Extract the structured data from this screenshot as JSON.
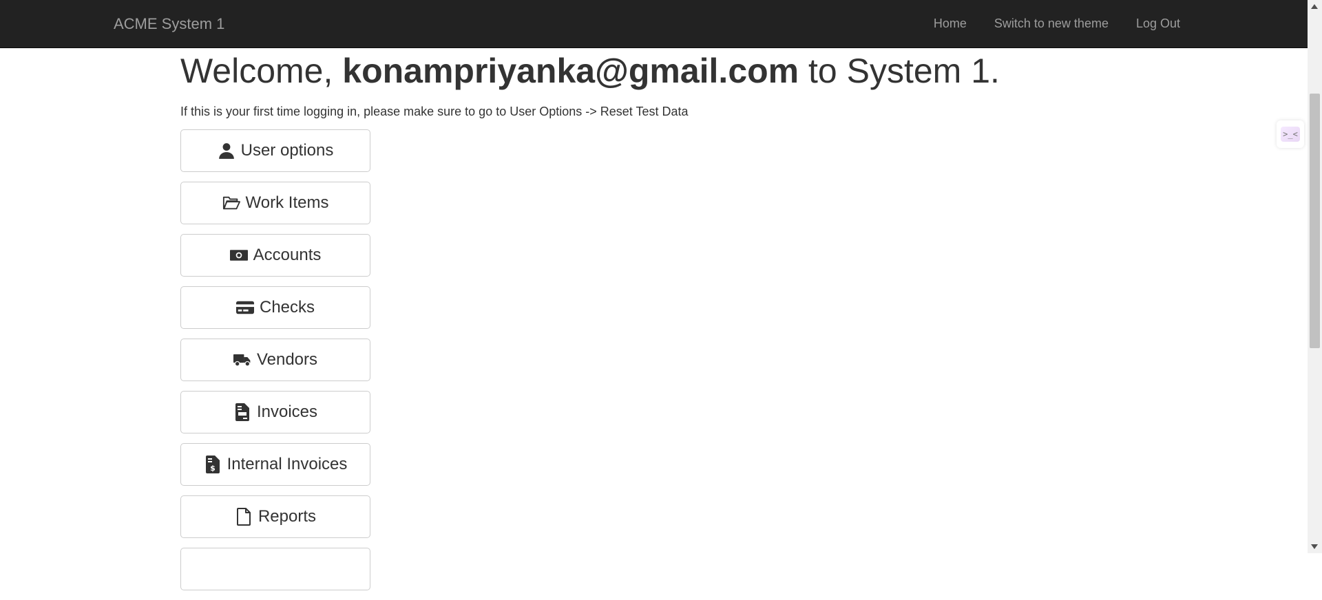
{
  "navbar": {
    "brand": "ACME System 1",
    "links": [
      {
        "label": "Home"
      },
      {
        "label": "Switch to new theme"
      },
      {
        "label": "Log Out"
      }
    ]
  },
  "welcome": {
    "prefix": "Welcome, ",
    "email": "konampriyanka@gmail.com",
    "suffix": " to System 1."
  },
  "hint": "If this is your first time logging in, please make sure to go to User Options -> Reset Test Data",
  "menu": [
    {
      "label": "User options",
      "icon": "user-icon"
    },
    {
      "label": "Work Items",
      "icon": "folder-open-icon"
    },
    {
      "label": "Accounts",
      "icon": "money-bill-icon"
    },
    {
      "label": "Checks",
      "icon": "credit-card-icon"
    },
    {
      "label": "Vendors",
      "icon": "truck-icon"
    },
    {
      "label": "Invoices",
      "icon": "file-invoice-icon"
    },
    {
      "label": "Internal Invoices",
      "icon": "file-invoice-dollar-icon"
    },
    {
      "label": "Reports",
      "icon": "file-icon"
    }
  ],
  "side_widget": {
    "text": ">_<",
    "icon": "assistant-widget-icon"
  }
}
